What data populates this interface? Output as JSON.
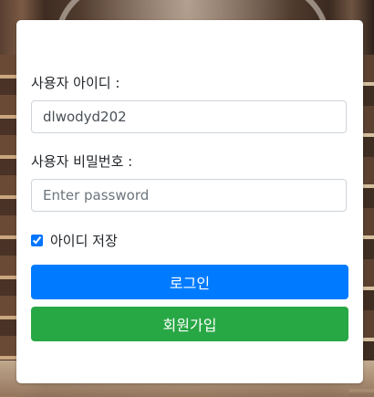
{
  "form": {
    "username_label": "사용자 아이디 :",
    "username_value": "dlwodyd202",
    "password_label": "사용자 비밀번호 :",
    "password_placeholder": "Enter password",
    "remember_label": "아이디 저장",
    "remember_checked": true,
    "login_button": "로그인",
    "signup_button": "회원가입"
  },
  "colors": {
    "primary": "#007bff",
    "success": "#28a745"
  }
}
